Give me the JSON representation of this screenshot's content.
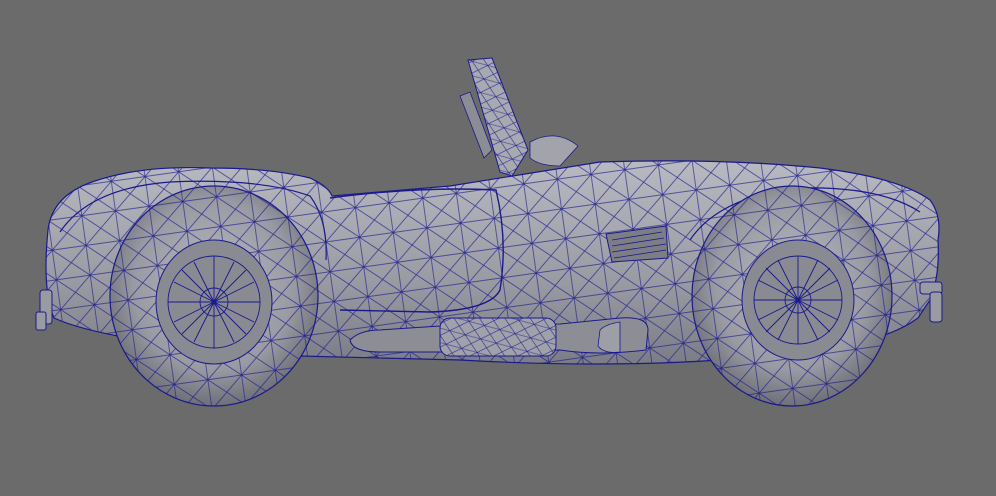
{
  "viewport": {
    "background_color": "#6b6b6b",
    "shaded_surface_color": "#9a9aa3",
    "surface_highlight_color": "#b9b9c1",
    "wireframe_color": "#1a1a8c",
    "display_mode": "wireframe-on-shaded"
  },
  "model": {
    "subject": "car-model",
    "view": "side"
  }
}
